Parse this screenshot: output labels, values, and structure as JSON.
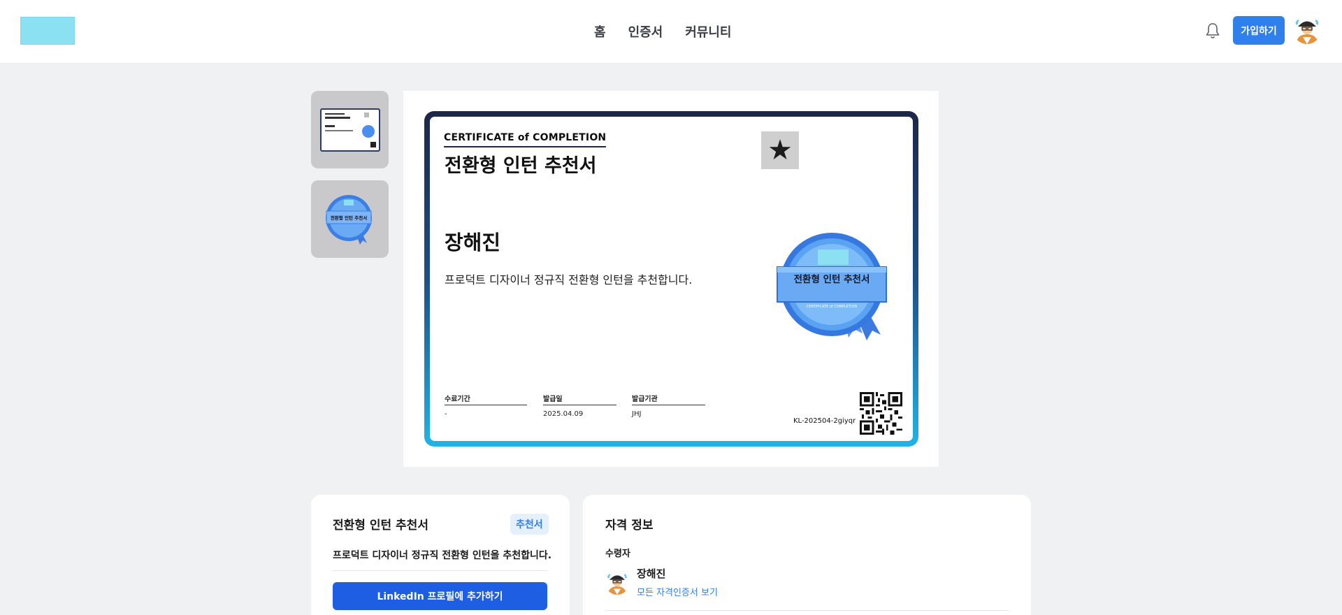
{
  "header": {
    "nav": [
      "홈",
      "인증서",
      "커뮤니티"
    ],
    "join_label": "가입하기"
  },
  "certificate": {
    "eyebrow": "CERTIFICATE of COMPLETION",
    "title": "전환형 인턴 추천서",
    "recipient": "장해진",
    "description": "프로덕트 디자이너 정규직 전환형 인턴을 추천합니다.",
    "seal_title": "전환형 인턴 추천서",
    "seal_subtitle": "CERTIFICATE of COMPLETION",
    "thumb_seal_title": "전환형 인턴 추천서",
    "meta": [
      {
        "label": "수료기간",
        "value": "-"
      },
      {
        "label": "발급일",
        "value": "2025.04.09"
      },
      {
        "label": "발급기관",
        "value": "JHJ"
      }
    ],
    "code": "KL-202504-2giyqr"
  },
  "summary_card": {
    "title": "전환형 인턴 추천서",
    "badge": "추천서",
    "description": "프로덕트 디자이너 정규직 전환형 인턴을 추천합니다.",
    "linkedin_label": "LinkedIn 프로필에 추가하기"
  },
  "info_card": {
    "title": "자격 정보",
    "recipient_label": "수령자",
    "recipient_name": "장해진",
    "view_all_link": "모든 자격인증서 보기"
  },
  "colors": {
    "accent": "#2f80ed",
    "linkedin_button": "#1d5ee3",
    "logo_placeholder": "#8be1f2",
    "cert_border_top": "#1d2748",
    "cert_border_bottom": "#22b3e6"
  },
  "icons": {
    "bell": "bell-icon",
    "star": "star-icon",
    "qr": "qr-code-icon"
  }
}
